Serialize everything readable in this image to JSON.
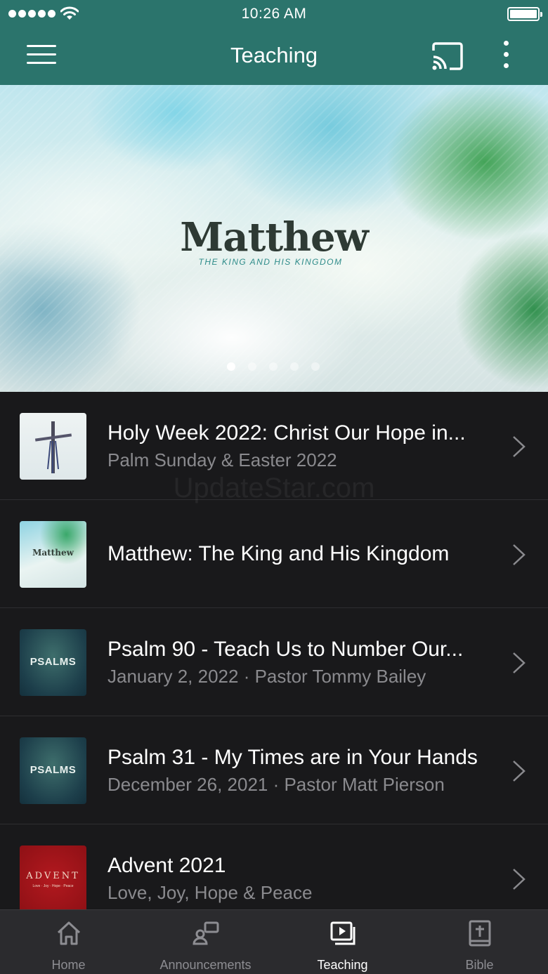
{
  "status_bar": {
    "time": "10:26 AM",
    "signal_icon": "signal-dots-icon",
    "wifi_icon": "wifi-icon",
    "battery_icon": "battery-full-icon"
  },
  "header": {
    "title": "Teaching",
    "menu_icon": "hamburger-menu-icon",
    "cast_icon": "cast-icon",
    "more_icon": "more-vertical-icon",
    "background_color": "#2b746c"
  },
  "hero": {
    "title": "Matthew",
    "subtitle": "THE KING AND HIS KINGDOM",
    "carousel_page_count": 5,
    "carousel_active_index": 0
  },
  "list": {
    "items": [
      {
        "title": "Holy Week 2022:  Christ Our Hope in...",
        "subtitle": "Palm Sunday & Easter 2022",
        "thumbnail": "cross-artwork"
      },
      {
        "title": "Matthew:  The King and His Kingdom",
        "subtitle": "",
        "thumbnail": "matthew-artwork",
        "thumb_text": "Matthew"
      },
      {
        "title": "Psalm 90 - Teach Us to Number Our...",
        "subtitle": "January 2, 2022 · Pastor Tommy Bailey",
        "thumbnail": "psalms-artwork",
        "thumb_text": "PSALMS"
      },
      {
        "title": "Psalm 31 - My Times are in Your Hands",
        "subtitle": "December 26, 2021 · Pastor Matt Pierson",
        "thumbnail": "psalms-artwork",
        "thumb_text": "PSALMS"
      },
      {
        "title": "Advent 2021",
        "subtitle": "Love, Joy, Hope & Peace",
        "thumbnail": "advent-artwork",
        "thumb_text": "ADVENT",
        "thumb_subtext": "Love · Joy · Hope · Peace"
      }
    ],
    "chevron_icon": "chevron-right-icon"
  },
  "watermark": "UpdateStar.com",
  "tab_bar": {
    "tabs": [
      {
        "label": "Home",
        "icon": "home-icon",
        "active": false
      },
      {
        "label": "Announcements",
        "icon": "announcements-icon",
        "active": false
      },
      {
        "label": "Teaching",
        "icon": "video-play-icon",
        "active": true
      },
      {
        "label": "Bible",
        "icon": "bible-icon",
        "active": false
      }
    ]
  }
}
